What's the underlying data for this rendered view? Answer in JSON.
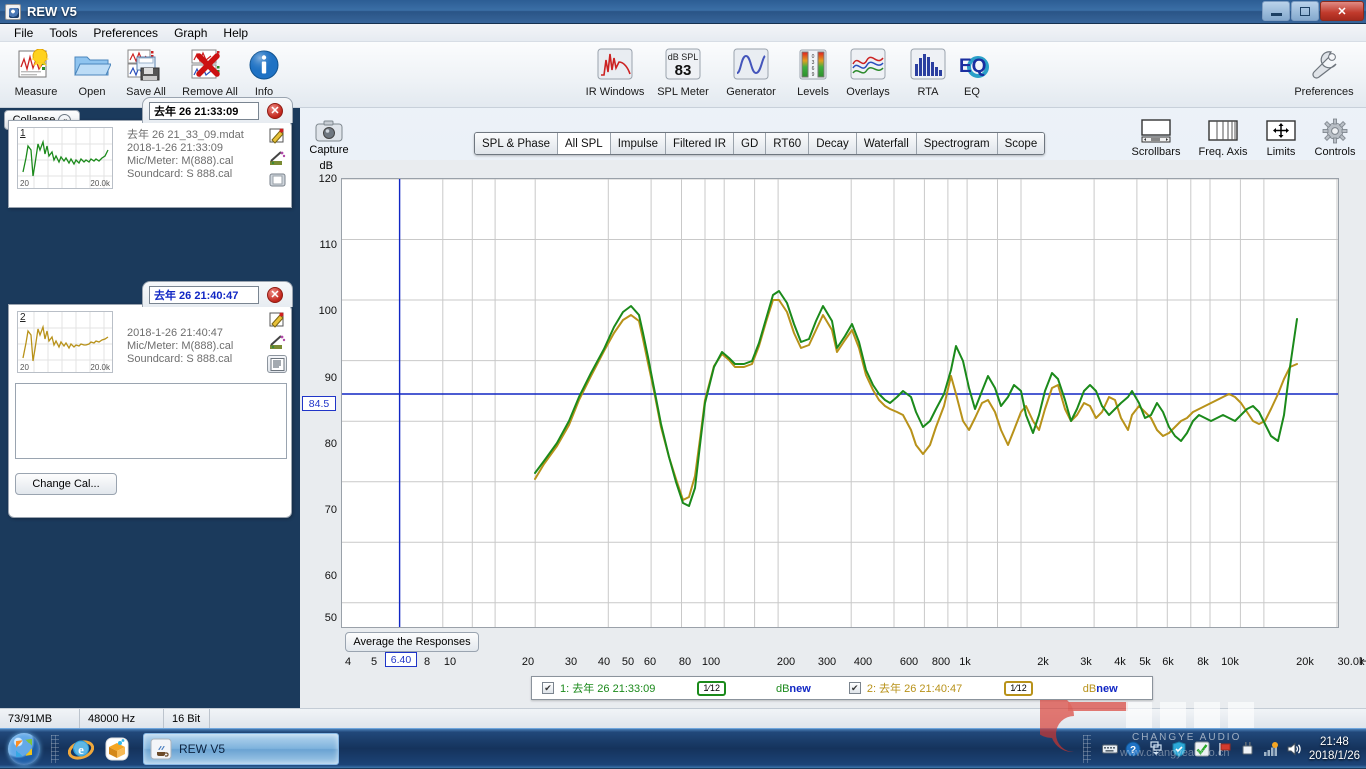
{
  "window": {
    "title": "REW V5",
    "minimize_label": "Minimize",
    "maximize_label": "Restore",
    "close_label": "Close"
  },
  "menu": [
    "File",
    "Tools",
    "Preferences",
    "Graph",
    "Help"
  ],
  "toolbar_left": [
    {
      "label": "Measure",
      "icon": "measure-icon"
    },
    {
      "label": "Open",
      "icon": "folder-open-icon"
    },
    {
      "label": "Save All",
      "icon": "save-all-icon"
    },
    {
      "label": "Remove All",
      "icon": "remove-all-icon"
    },
    {
      "label": "Info",
      "icon": "info-icon"
    }
  ],
  "toolbar_center": [
    {
      "label": "IR Windows",
      "icon": "ir-windows-icon"
    },
    {
      "label": "SPL Meter",
      "icon": "spl-meter-icon",
      "value": "83",
      "unit": "dB SPL"
    },
    {
      "label": "Generator",
      "icon": "generator-icon"
    },
    {
      "label": "Levels",
      "icon": "levels-icon"
    },
    {
      "label": "Overlays",
      "icon": "overlays-icon"
    },
    {
      "label": "RTA",
      "icon": "rta-icon"
    },
    {
      "label": "EQ",
      "icon": "eq-icon"
    }
  ],
  "toolbar_right": [
    {
      "label": "Preferences",
      "icon": "wrench-icon"
    }
  ],
  "sidebar": {
    "collapse_label": "Collapse",
    "change_cal_label": "Change Cal...",
    "notes_value": "",
    "measurements": [
      {
        "index": "1",
        "name": "去年 26 21:33:09",
        "file": "去年 26 21_33_09.mdat",
        "date": "2018-1-26 21:33:09",
        "mic": "Mic/Meter: M(888).cal",
        "soundcard": "Soundcard: S 888.cal",
        "thumb_min": "20",
        "thumb_max": "20.0k",
        "color": "#1b8a1b"
      },
      {
        "index": "2",
        "name": "去年 26 21:40:47",
        "file": "",
        "date": "2018-1-26 21:40:47",
        "mic": "Mic/Meter: M(888).cal",
        "soundcard": "Soundcard: S 888.cal",
        "thumb_min": "20",
        "thumb_max": "20.0k",
        "color": "#b8921a"
      }
    ]
  },
  "capture": {
    "label": "Capture",
    "icon": "camera-icon"
  },
  "graph_tabs": [
    {
      "label": "SPL & Phase",
      "active": false
    },
    {
      "label": "All SPL",
      "active": true
    },
    {
      "label": "Impulse",
      "active": false
    },
    {
      "label": "Filtered IR",
      "active": false
    },
    {
      "label": "GD",
      "active": false
    },
    {
      "label": "RT60",
      "active": false
    },
    {
      "label": "Decay",
      "active": false
    },
    {
      "label": "Waterfall",
      "active": false
    },
    {
      "label": "Spectrogram",
      "active": false
    },
    {
      "label": "Scope",
      "active": false
    }
  ],
  "graph_toolbar": [
    {
      "label": "Scrollbars",
      "icon": "scrollbars-icon"
    },
    {
      "label": "Freq. Axis",
      "icon": "freq-axis-icon"
    },
    {
      "label": "Limits",
      "icon": "limits-icon"
    },
    {
      "label": "Controls",
      "icon": "gear-icon"
    }
  ],
  "graph": {
    "average_button": "Average the Responses",
    "y_cursor_value": "84.5",
    "x_cursor_value": "6.40",
    "x_unit": "Hz",
    "legend": [
      {
        "checked": true,
        "label": "1: 去年 26 21:33:09",
        "smoothing_num": "1",
        "smoothing_den": "12",
        "db": "dB",
        "new": "new",
        "color": "#1b8a1b"
      },
      {
        "checked": true,
        "label": "2: 去年 26 21:40:47",
        "smoothing_num": "1",
        "smoothing_den": "12",
        "db": "dB",
        "new": "new",
        "color": "#b8921a"
      }
    ]
  },
  "chart_data": {
    "type": "line",
    "title": "All SPL",
    "xlabel": "Hz",
    "ylabel": "dB",
    "xscale": "log",
    "xlim": [
      4,
      30000
    ],
    "ylim": [
      46,
      120
    ],
    "yticks": [
      50,
      60,
      70,
      80,
      90,
      100,
      110,
      120
    ],
    "ytick_labels": [
      "50",
      "60",
      "70",
      "80",
      "90",
      "100",
      "110",
      "120"
    ],
    "xticks": [
      4,
      5,
      6.4,
      8,
      10,
      20,
      30,
      40,
      50,
      60,
      80,
      100,
      200,
      300,
      400,
      600,
      800,
      1000,
      2000,
      3000,
      4000,
      5000,
      6000,
      8000,
      10000,
      20000,
      30000
    ],
    "xtick_labels": [
      "4",
      "5",
      "6.40",
      "8",
      "10",
      "20",
      "30",
      "40",
      "50",
      "60",
      "80",
      "100",
      "200",
      "300",
      "400",
      "600",
      "800",
      "1k",
      "2k",
      "3k",
      "4k",
      "5k",
      "6k",
      "8k",
      "10k",
      "20k",
      "30.0k"
    ],
    "grid": true,
    "legend_position": "bottom",
    "cursor_lines": {
      "horizontal_db": 84.5,
      "vertical_hz": 6.4
    },
    "series": [
      {
        "name": "1: 去年 26 21:33:09",
        "color": "#1b8a1b",
        "x": [
          20,
          22,
          25,
          28,
          31,
          35,
          40,
          45,
          50,
          55,
          60,
          63,
          66,
          70,
          75,
          80,
          85,
          90,
          95,
          100,
          105,
          110,
          118,
          125,
          133,
          140,
          150,
          160,
          170,
          180,
          190,
          200,
          212,
          224,
          236,
          250,
          265,
          280,
          300,
          315,
          335,
          355,
          375,
          400,
          425,
          450,
          475,
          500,
          530,
          560,
          600,
          630,
          670,
          710,
          750,
          800,
          850,
          900,
          950,
          1000,
          1060,
          1120,
          1180,
          1250,
          1320,
          1400,
          1500,
          1600,
          1700,
          1800,
          1900,
          2000,
          2120,
          2240,
          2360,
          2500,
          2650,
          2800,
          3000,
          3150,
          3350,
          3550,
          3750,
          4000,
          4250,
          4500,
          4750,
          5000,
          5300,
          5600,
          6000,
          6300,
          6700,
          7100,
          7500,
          8000,
          8500,
          9000,
          9500,
          10000,
          10600,
          11200,
          11800,
          12500,
          13200,
          14000,
          15000,
          16000,
          17000,
          18000,
          19000,
          20000
        ],
        "y": [
          71.5,
          73.5,
          76.5,
          80,
          84,
          88,
          92.5,
          96,
          98.5,
          99.5,
          98,
          95,
          91,
          86,
          80,
          74.5,
          69,
          65.5,
          65,
          68,
          75,
          82,
          88,
          90.5,
          89.5,
          88.5,
          88.5,
          89,
          92,
          96,
          100,
          102.5,
          101,
          97.5,
          95,
          95.5,
          98,
          100.5,
          98,
          94.5,
          96.5,
          98,
          95,
          90.5,
          88,
          86.5,
          85.5,
          85,
          86,
          87,
          86,
          84,
          81.5,
          80.5,
          80.5,
          81,
          85.5,
          89.5,
          87,
          84,
          86,
          88,
          86,
          83,
          81.5,
          83.5,
          87,
          88,
          86.5,
          82,
          79,
          82,
          86,
          89.5,
          88,
          84.5,
          81,
          83,
          86,
          88,
          87,
          84,
          82.5,
          83.5,
          84.5,
          85.5,
          87,
          85,
          82.5,
          83,
          85,
          84,
          82,
          80.5,
          79.5,
          80.5,
          82.5,
          83.5,
          83,
          82.5,
          83,
          83.5,
          84.5,
          85.5,
          86,
          85.5,
          84,
          81.5,
          80,
          80.5,
          85,
          90,
          92.5
        ]
      },
      {
        "name": "2: 去年 26 21:40:47",
        "color": "#b8921a",
        "x": [
          20,
          22,
          25,
          28,
          31,
          35,
          40,
          45,
          50,
          55,
          60,
          63,
          66,
          70,
          75,
          80,
          85,
          90,
          95,
          100,
          105,
          110,
          118,
          125,
          133,
          140,
          150,
          160,
          170,
          180,
          190,
          200,
          212,
          224,
          236,
          250,
          265,
          280,
          300,
          315,
          335,
          355,
          375,
          400,
          425,
          450,
          475,
          500,
          530,
          560,
          600,
          630,
          670,
          710,
          750,
          800,
          850,
          900,
          950,
          1000,
          1060,
          1120,
          1180,
          1250,
          1320,
          1400,
          1500,
          1600,
          1700,
          1800,
          1900,
          2000,
          2120,
          2240,
          2360,
          2500,
          2650,
          2800,
          3000,
          3150,
          3350,
          3550,
          3750,
          4000,
          4250,
          4500,
          4750,
          5000,
          5300,
          5600,
          6000,
          6300,
          6700,
          7100,
          7500,
          8000,
          8500,
          9000,
          9500,
          10000,
          10600,
          11200,
          11800,
          12500,
          13200,
          14000,
          15000,
          16000,
          17000,
          18000,
          19000,
          20000
        ],
        "y": [
          70.5,
          73,
          76,
          79.5,
          83.5,
          87.5,
          92,
          95.5,
          98,
          98.5,
          97.5,
          94.5,
          90.5,
          85.5,
          79.5,
          74,
          69,
          65.5,
          65.5,
          69,
          76,
          82.5,
          88,
          90,
          89,
          88,
          88,
          88.5,
          91.5,
          95.5,
          100,
          102.5,
          100.5,
          97,
          94.5,
          95,
          97.5,
          100,
          97.5,
          94,
          96,
          97.5,
          94.5,
          90,
          87.5,
          86,
          85,
          84.5,
          84,
          83.5,
          81,
          78.5,
          77,
          78.5,
          81.5,
          85,
          90,
          87,
          82.5,
          81,
          83,
          86.5,
          87,
          85,
          82.5,
          80,
          82.5,
          86,
          87.5,
          85,
          81.5,
          82.5,
          85,
          88.5,
          89,
          85,
          82.5,
          84,
          86.5,
          87,
          85.5,
          83,
          82,
          83.5,
          85,
          84,
          82.5,
          83.5,
          85.5,
          86,
          84,
          82.5,
          83.5,
          85,
          84,
          82.5,
          82,
          82.5,
          83.5,
          84.5,
          85,
          85.5,
          86,
          86.5,
          87,
          86.5,
          85.5,
          84,
          82.5,
          81.5,
          82,
          84.5,
          87.5
        ]
      }
    ]
  },
  "statusbar": {
    "memory": "73/91MB",
    "samplerate": "48000 Hz",
    "bitdepth": "16 Bit"
  },
  "taskbar": {
    "start_label": "Start",
    "items": [
      {
        "label": "Internet Explorer",
        "icon": "ie-icon"
      },
      {
        "label": "Kuaiya",
        "icon": "package-icon"
      }
    ],
    "active_task": "REW V5",
    "tray_icons": [
      "keyboard-icon",
      "help-icon",
      "show-hidden-icon",
      "shield-icon",
      "check-icon",
      "flag-icon",
      "plug-icon",
      "network-icon",
      "volume-icon"
    ],
    "clock_time": "21:48",
    "clock_date": "2018/1/26"
  },
  "watermark": {
    "brand": "CHANGYE AUDIO",
    "cn": "昌业音响",
    "url": "www.changyeaudio.cn"
  }
}
